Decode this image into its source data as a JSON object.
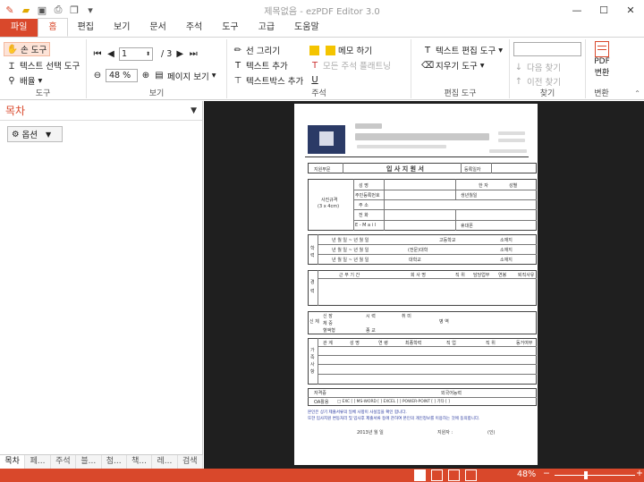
{
  "window": {
    "title": "제목없음 - ezPDF Editor 3.0",
    "controls": [
      "—",
      "☐",
      "✕"
    ]
  },
  "tabs": [
    "파일",
    "홈",
    "편집",
    "보기",
    "문서",
    "주석",
    "도구",
    "고급",
    "도움말"
  ],
  "ribbon": {
    "tools": {
      "hand": "손 도구",
      "text_select": "텍스트 선택 도구",
      "zoom": "배율",
      "label": "도구"
    },
    "view": {
      "page_value": "1",
      "page_total": "/ 3",
      "zoom_value": "48 %",
      "page_view": "페이지 보기",
      "label": "보기"
    },
    "annot": {
      "line": "선 그리기",
      "text_add": "텍스트 추가",
      "textbox_add": "텍스트박스 추가",
      "memo": "메모 하기",
      "flatten": "모든 주석 플래트닝",
      "label": "주석"
    },
    "edit": {
      "text_edit": "텍스트 편집 도구",
      "eraser": "지우기 도구",
      "label": "편집 도구"
    },
    "find": {
      "next": "다음 찾기",
      "prev": "이전 찾기",
      "label": "찾기"
    },
    "convert": {
      "pdf_line1": "PDF",
      "pdf_line2": "변환",
      "label": "변환"
    }
  },
  "left_panel": {
    "title": "목차",
    "options": "옵션",
    "tabs": [
      "목차",
      "페...",
      "주석",
      "블...",
      "첨...",
      "책...",
      "레...",
      "검색"
    ]
  },
  "document": {
    "form_title": "입 사 지 원 서",
    "apply_dept": "지원부문",
    "reg_no": "등록일자",
    "photo": "사진규격",
    "photo_size": "(3 x 4cm)",
    "name": "성 명",
    "resident_no": "주민등록번호",
    "address": "주 소",
    "phone": "전 화",
    "email": "E - M a i l",
    "hanja": "한 자",
    "gender": "성별",
    "birth": "생년월일",
    "contact": "휴대폰",
    "edu_period_1": "년 월 일 ~ 년 월 일",
    "edu_period_2": "년 월 일 ~ 년 월 일",
    "edu_period_3": "년 월 일 ~ 년 월 일",
    "hs": "고등학교",
    "college": "(전문)대학",
    "univ": "대학교",
    "location": "소재지",
    "edu_label": "학 력",
    "career_label": "경 력",
    "career_period": "근 무 기 간",
    "company": "회 사 명",
    "position": "직 위",
    "duty": "담당업무",
    "salary": "연봉",
    "reason": "퇴직사유",
    "body_label": "신 체",
    "height": "신 장",
    "weight": "체 중",
    "sight": "시 력",
    "blood": "혈액형",
    "military": "병 역",
    "hobby": "취 미",
    "religion": "종 교",
    "family_label": "가 족 사 항",
    "relation": "관 계",
    "fam_name": "성 명",
    "age": "연 령",
    "school": "최종학력",
    "job": "직 업",
    "fam_position": "직 위",
    "together": "동거여부",
    "cert": "자격증",
    "oa": "OA활용",
    "oa_items": "□ EXC [ ] MS-WORD [ ] EXCEL [ ] POWER-POINT [ ] 기타 [ ]",
    "foreign": "외국어능력",
    "notice1": "본인은 상기 제출서류의 일체 사항이 사실임을 확인 합니다.",
    "notice2": "또한 입사지원 변동처리 및 입사후 제출서류 등에 관하여 본인의 개인정보를 이용하는 것에 동의합니다.",
    "date": "2013년     월     일",
    "applicant": "지원자 :",
    "seal": "(인)"
  },
  "status": {
    "zoom": "48%",
    "minus": "−",
    "plus": "+"
  },
  "colors": {
    "accent": "#d9482b",
    "viewer_bg": "#1f1f1f"
  }
}
